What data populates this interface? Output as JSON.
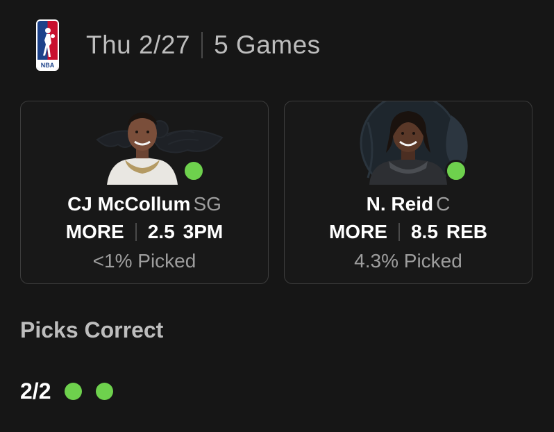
{
  "header": {
    "date": "Thu 2/27",
    "games": "5 Games",
    "league_icon": "nba-logo-icon"
  },
  "cards": [
    {
      "player": "CJ McCollum",
      "position": "SG",
      "pick": "MORE",
      "line": "2.5",
      "stat": "3PM",
      "picked": "<1% Picked",
      "status": "correct",
      "team_icon": "pelicans-logo-icon"
    },
    {
      "player": "N. Reid",
      "position": "C",
      "pick": "MORE",
      "line": "8.5",
      "stat": "REB",
      "picked": "4.3% Picked",
      "status": "correct",
      "team_icon": "timberwolves-logo-icon"
    }
  ],
  "results": {
    "title": "Picks Correct",
    "score": "2/2",
    "correct_count": 2
  },
  "colors": {
    "background": "#161616",
    "correct": "#6ed14d",
    "muted_text": "#9e9e9e",
    "border": "#3d3d3d"
  }
}
